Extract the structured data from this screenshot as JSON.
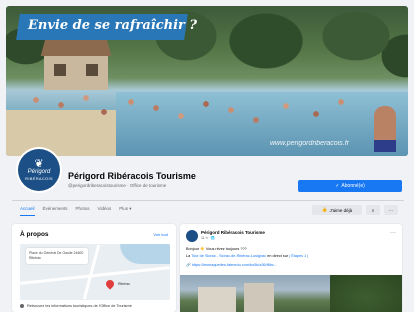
{
  "cover": {
    "banner_text": "Envie de se rafraîchir ?",
    "signature": "www.perigordriberacois.fr"
  },
  "profile": {
    "logo_line1": "Périgord",
    "logo_line2": "RIBÉRACOIS",
    "name": "Périgord Ribéracois Tourisme",
    "subtitle": "@perigordriberacoistourisme · Office de tourisme",
    "follow_button": "Abonné(e)"
  },
  "tabs": {
    "items": [
      "Accueil",
      "Événements",
      "Photos",
      "Vidéos",
      "Plus ▾"
    ],
    "active_index": 0,
    "likes_button": "J'aime déjà",
    "search_icon": "search-icon",
    "more_icon": "more-icon"
  },
  "about": {
    "title": "À propos",
    "see_all": "Voir tout",
    "map_address": "Place du Général De Gaulle 24600 Ribérac",
    "pin_label": "Ribérac",
    "line1": "Retrouvez les informations touristiques de l'Office de Tourisme"
  },
  "post": {
    "author": "Périgord Ribéracois Tourisme",
    "date": "11 h · 🌐",
    "line1": "Bonjour ☀️ Vous rêvez toujours ???",
    "line2_prefix": "La",
    "line2_link": "Tour de Siorac - Siorac-de-Ribérac-Lusignac",
    "line2_suffix": "en direct sur",
    "line2_link2": "| Étapes 1 |",
    "url": "https://lesmaquettes-fatmedu.com/bo5k/a36/f6bc..."
  }
}
